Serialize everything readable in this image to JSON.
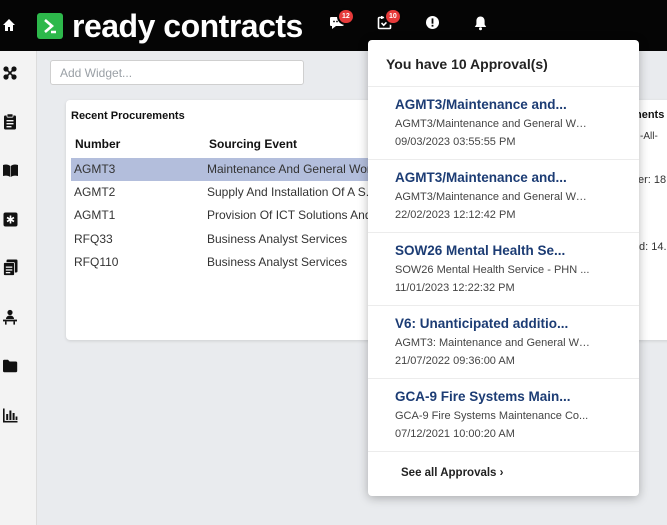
{
  "brand": {
    "name": "ready contracts"
  },
  "header": {
    "messages_count": "12",
    "approvals_count": "10"
  },
  "main": {
    "add_widget_placeholder": "Add Widget...",
    "recent": {
      "title": "Recent Procurements",
      "columns": [
        "Number",
        "Sourcing Event"
      ],
      "rows": [
        {
          "number": "AGMT3",
          "event": "Maintenance And General Work",
          "selected": true
        },
        {
          "number": "AGMT2",
          "event": "Supply And Installation Of A S..."
        },
        {
          "number": "AGMT1",
          "event": "Provision Of ICT Solutions And..."
        },
        {
          "number": "RFQ33",
          "event": "Business Analyst Services"
        },
        {
          "number": "RFQ110",
          "event": "Business Analyst Services"
        }
      ]
    },
    "side_card": {
      "title_fragment": "nents",
      "filter_fragment": "-All-",
      "line1_fragment": "er: 18.",
      "line2_fragment": "d: 14.8"
    }
  },
  "approvals": {
    "header": "You have 10 Approval(s)",
    "items": [
      {
        "title": "AGMT3/Maintenance and...",
        "desc": "AGMT3/Maintenance and General Wo...",
        "date": "09/03/2023 03:55:55 PM"
      },
      {
        "title": "AGMT3/Maintenance and...",
        "desc": "AGMT3/Maintenance and General Wo...",
        "date": "22/02/2023 12:12:42 PM"
      },
      {
        "title": "SOW26 Mental Health Se...",
        "desc": "SOW26 Mental Health Service - PHN ...",
        "date": "11/01/2023 12:22:32 PM"
      },
      {
        "title": "V6: Unanticipated additio...",
        "desc": "AGMT3: Maintenance and General Wo...",
        "date": "21/07/2022 09:36:00 AM"
      },
      {
        "title": "GCA-9 Fire Systems Main...",
        "desc": "GCA-9 Fire Systems Maintenance Co...",
        "date": "07/12/2021 10:00:20 AM"
      }
    ],
    "see_all": "See all Approvals ›"
  },
  "colors": {
    "topbar": "#050505",
    "brand_green": "#2db84b",
    "badge_red": "#e63a3a",
    "link_navy": "#1c3c74",
    "row_selected": "#b3bedc"
  }
}
